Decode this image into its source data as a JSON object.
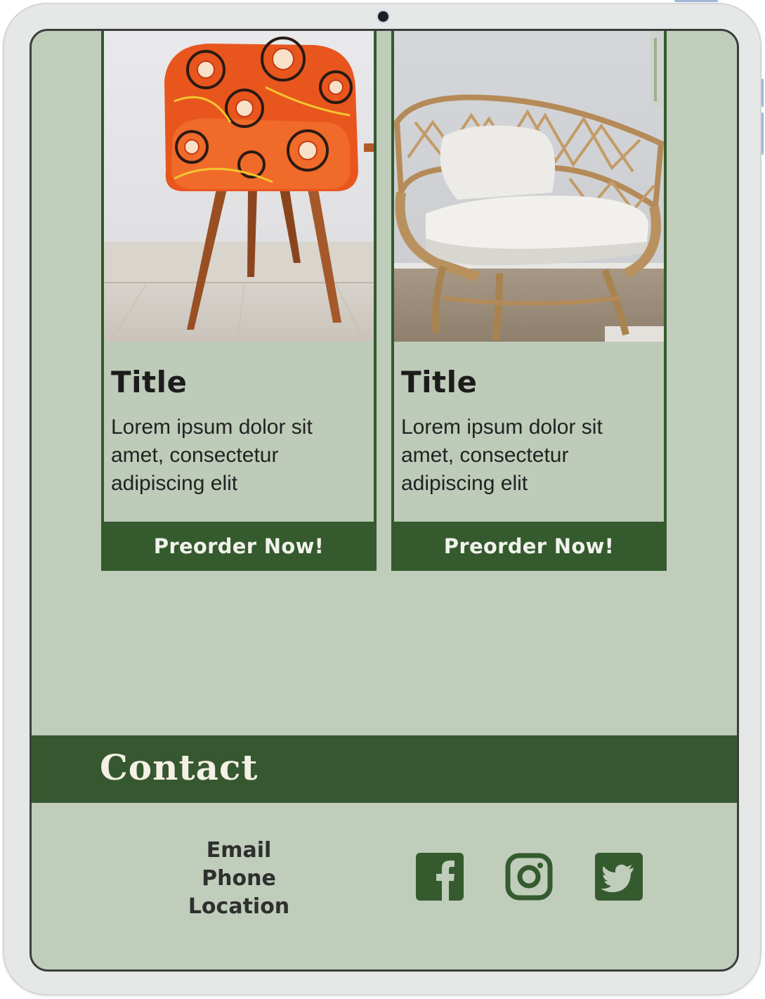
{
  "products": [
    {
      "title": "Title",
      "description": "Lorem ipsum dolor sit amet, consectetur adipiscing elit",
      "button_label": "Preorder Now!",
      "image": "orange-patterned-chair"
    },
    {
      "title": "Title",
      "description": "Lorem ipsum dolor sit amet, consectetur adipiscing elit",
      "button_label": "Preorder Now!",
      "image": "rattan-armchair"
    }
  ],
  "contact": {
    "heading": "Contact",
    "items": [
      "Email",
      "Phone",
      "Location"
    ],
    "social": [
      {
        "name": "facebook-icon"
      },
      {
        "name": "instagram-icon"
      },
      {
        "name": "twitter-icon"
      }
    ]
  },
  "colors": {
    "page_background": "#bfcdba",
    "accent_green": "#345a2e",
    "button_text": "#f2f2ec",
    "contact_heading_text": "#f4f1e4",
    "device_frame": "#e6e8e7"
  }
}
